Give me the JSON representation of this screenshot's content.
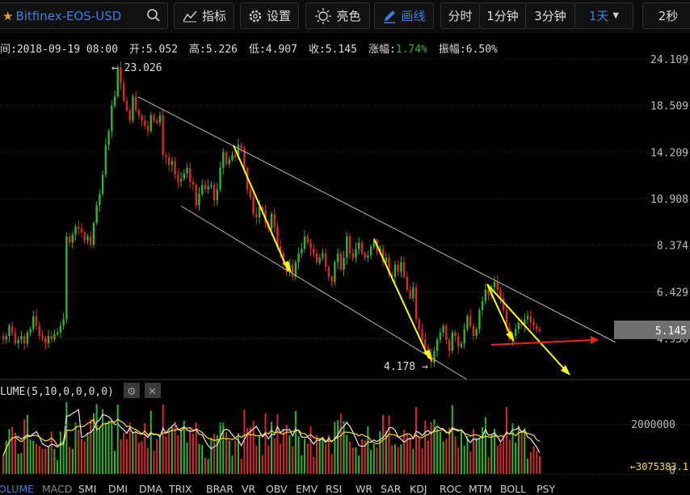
{
  "toolbar": {
    "symbol": "Bitfinex-EOS-USD",
    "indicator": "指标",
    "settings": "设置",
    "brightness": "亮色",
    "draw": "画线",
    "periods": [
      "分时",
      "1分钟",
      "3分钟"
    ],
    "active_period": "1天",
    "refresh": "2秒"
  },
  "info": {
    "time": "间:2018-09-19 08:00",
    "open": "开:5.052",
    "high": "高:5.226",
    "low": "低:4.907",
    "close_label": "收:5.145",
    "change_label": "涨幅:",
    "change_value": "1.74%",
    "amplitude": "振幅:6.50%"
  },
  "colors": {
    "up": "#2fb52f",
    "down": "#d82a2a",
    "accent": "#3a7fdc",
    "yellow": "#ffff00",
    "arrow_red": "#ff2020"
  },
  "chart_data": {
    "type": "candlestick",
    "price_axis_ticks": [
      "24.109",
      "18.509",
      "14.209",
      "10.908",
      "8.374",
      "6.429",
      "4.936"
    ],
    "price_log_scale": true,
    "current_price": "5.145",
    "max_label": "← 23.026",
    "min_label": "4.178 →",
    "price_path": [
      4.9,
      5.0,
      5.3,
      5.1,
      4.8,
      4.9,
      5.0,
      4.8,
      5.1,
      5.2,
      5.6,
      5.3,
      5.0,
      4.95,
      4.8,
      5.0,
      4.9,
      5.05,
      5.1,
      5.3,
      5.5,
      8.8,
      8.5,
      8.9,
      9.3,
      9.2,
      9.0,
      8.6,
      8.8,
      8.4,
      9.5,
      10.5,
      11.2,
      12.5,
      14.8,
      16.0,
      18.5,
      19.5,
      23.0,
      21.0,
      19.0,
      18.0,
      17.0,
      19.5,
      18.0,
      17.5,
      17.0,
      16.5,
      16.0,
      17.5,
      17.0,
      16.8,
      17.5,
      14.0,
      13.8,
      13.2,
      13.5,
      12.5,
      12.0,
      12.2,
      12.6,
      13.0,
      12.0,
      11.8,
      10.5,
      11.2,
      11.8,
      11.5,
      11.7,
      11.8,
      10.8,
      11.5,
      13.0,
      14.2,
      13.3,
      13.6,
      14.0,
      13.8,
      14.8,
      14.5,
      13.0,
      11.5,
      11.0,
      10.0,
      9.8,
      10.4,
      10.2,
      9.5,
      9.2,
      10.0,
      9.3,
      8.3,
      8.0,
      7.5,
      7.2,
      7.5,
      7.0,
      7.6,
      8.0,
      8.2,
      8.8,
      8.5,
      8.2,
      8.0,
      7.6,
      7.8,
      8.0,
      7.4,
      7.0,
      6.8,
      7.6,
      8.0,
      7.3,
      7.8,
      8.8,
      8.0,
      7.8,
      8.2,
      8.5,
      8.0,
      7.8,
      7.9,
      8.3,
      8.6,
      8.1,
      8.2,
      7.6,
      7.8,
      7.1,
      7.0,
      7.5,
      7.2,
      7.6,
      7.0,
      6.5,
      6.2,
      6.6,
      5.5,
      5.2,
      4.9,
      4.7,
      4.5,
      4.3,
      4.6,
      4.9,
      5.1,
      5.3,
      4.9,
      4.6,
      5.1,
      5.0,
      4.7,
      4.8,
      5.2,
      5.6,
      5.3,
      5.0,
      5.2,
      5.8,
      6.1,
      6.5,
      6.3,
      6.6,
      6.8,
      6.5,
      6.2,
      5.8,
      5.2,
      4.9,
      5.0,
      5.2,
      5.4,
      5.3,
      5.5,
      5.6,
      5.4,
      5.3,
      5.2,
      5.145
    ],
    "volume_axis_ticks": [
      "2000000",
      "0"
    ],
    "volume_last": "←3075383.1",
    "volume_label": "LUME(5,10,0,0,0,0)"
  },
  "indicator_tabs": [
    "OLUME",
    "MACD",
    "SMI",
    "DMI",
    "DMA",
    "TRIX",
    "BRAR",
    "VR",
    "OBV",
    "EMV",
    "RSI",
    "WR",
    "SAR",
    "KDJ",
    "ROC",
    "MTM",
    "BOLL",
    "PSY"
  ]
}
